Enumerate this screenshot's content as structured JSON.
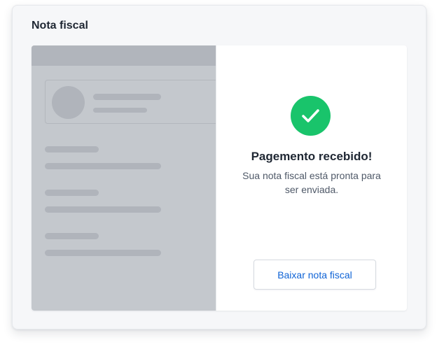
{
  "card": {
    "title": "Nota fiscal"
  },
  "status": {
    "icon": "check-circle-icon",
    "title": "Pagemento recebido!",
    "message": "Sua nota fiscal está pronta para ser enviada."
  },
  "actions": {
    "download_label": "Baixar nota fiscal"
  },
  "colors": {
    "accent": "#0f63d6",
    "success": "#19c46b",
    "preview_background": "#c4c8cd"
  }
}
